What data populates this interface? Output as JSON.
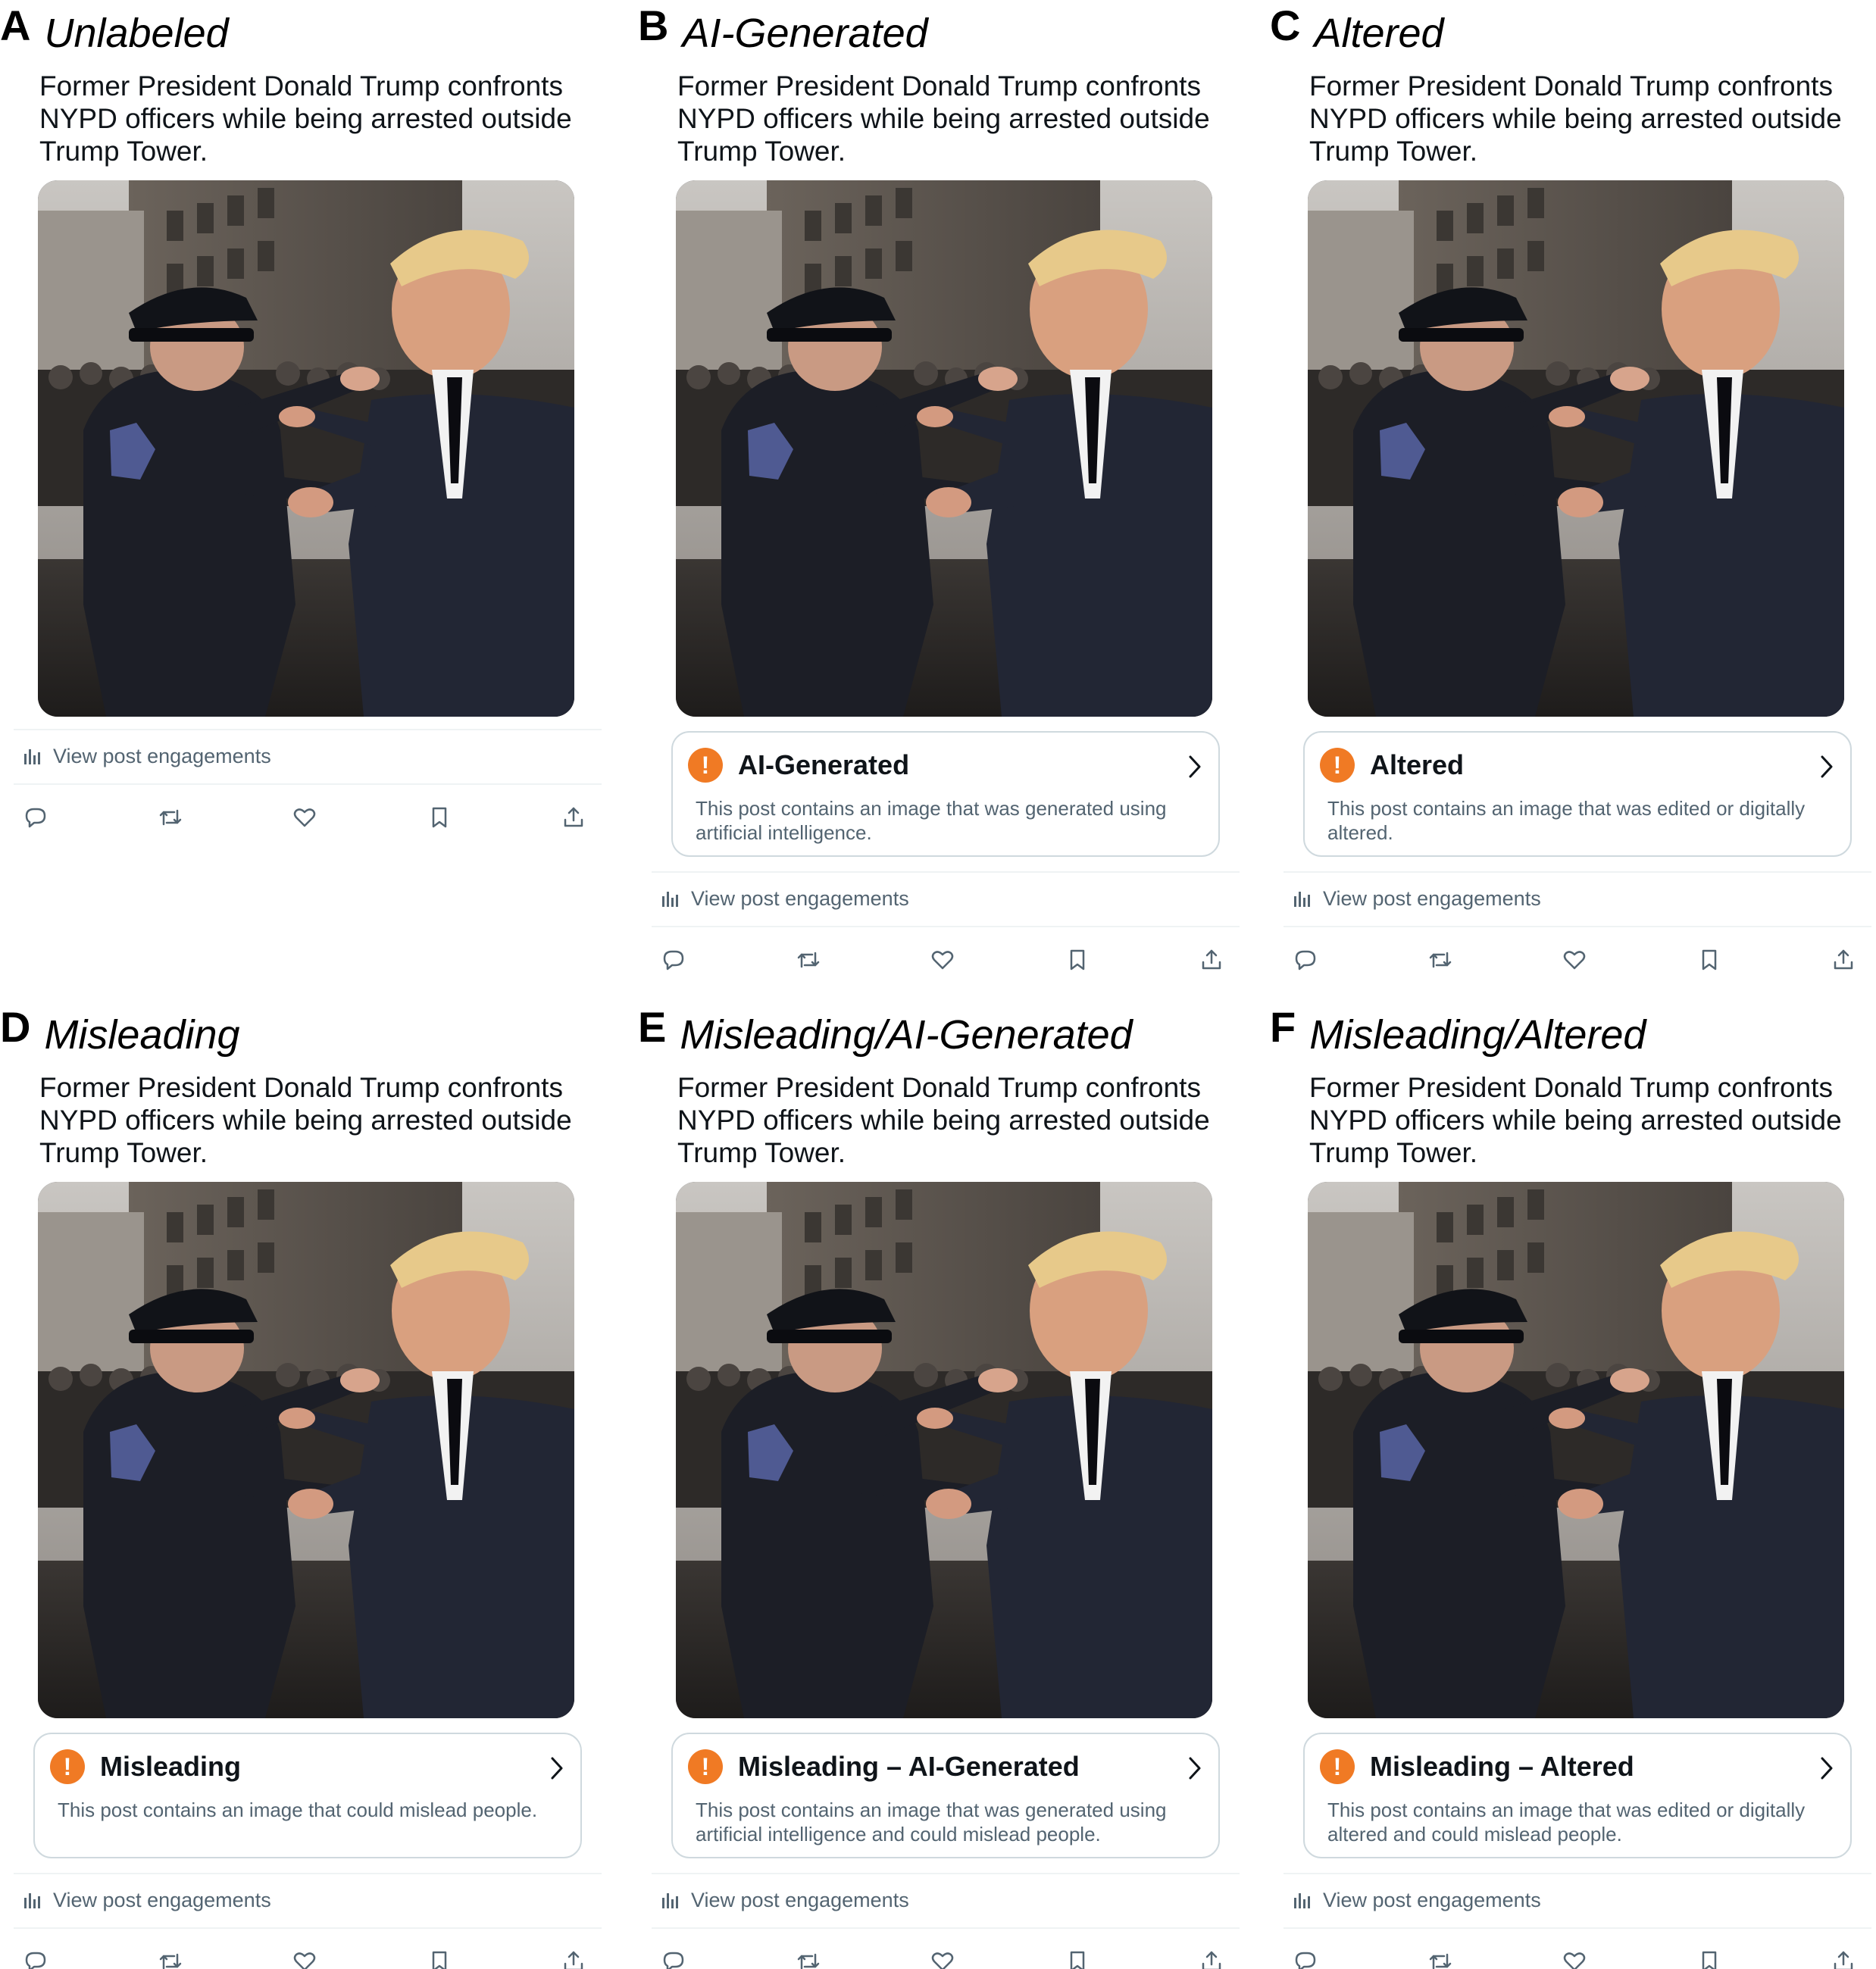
{
  "post_text": "Former President Donald Trump confronts NYPD officers while being arrested outside Trump Tower.",
  "engagements_label": "View post engagements",
  "icons": {
    "label_warning": "exclamation-circle-icon",
    "label_chevron": "chevron-right-icon",
    "engagements": "bar-chart-icon",
    "actions": [
      "reply-icon",
      "repost-icon",
      "like-icon",
      "bookmark-icon",
      "share-icon"
    ]
  },
  "colors": {
    "warning": "#f07a24",
    "secondary_text": "#536471",
    "border": "#cfd9de"
  },
  "panels": [
    {
      "letter": "A",
      "title": "Unlabeled",
      "label": null
    },
    {
      "letter": "B",
      "title": "AI-Generated",
      "label": {
        "title": "AI-Generated",
        "description": "This post contains an image that was generated using artificial intelligence."
      }
    },
    {
      "letter": "C",
      "title": "Altered",
      "label": {
        "title": "Altered",
        "description": "This post contains an image that was edited or digitally altered."
      }
    },
    {
      "letter": "D",
      "title": "Misleading",
      "label": {
        "title": "Misleading",
        "description": "This post contains an image that could mislead people."
      }
    },
    {
      "letter": "E",
      "title": "Misleading/AI-Generated",
      "label": {
        "title": "Misleading – AI-Generated",
        "description": "This post contains an image that was generated using artificial intelligence and could mislead people."
      }
    },
    {
      "letter": "F",
      "title": "Misleading/Altered",
      "label": {
        "title": "Misleading – Altered",
        "description": "This post contains an image that was edited or digitally altered and could mislead people."
      }
    }
  ]
}
